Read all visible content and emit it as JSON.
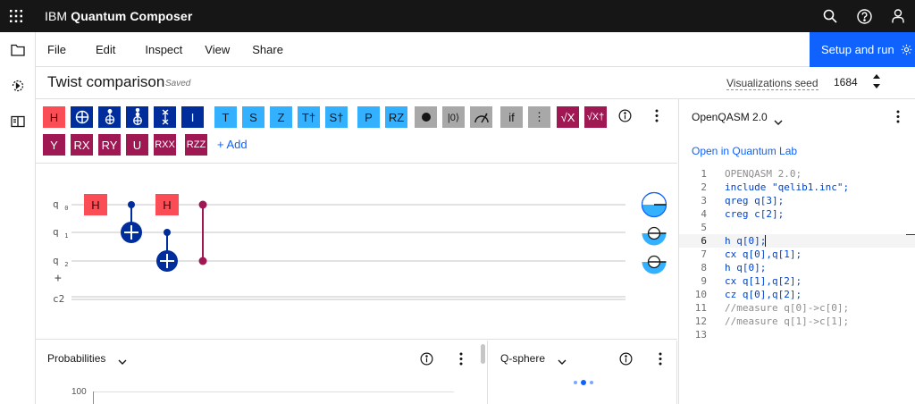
{
  "app": {
    "brand_prefix": "IBM",
    "brand_name": "Quantum Composer"
  },
  "menu": [
    "File",
    "Edit",
    "Inspect",
    "View",
    "Share"
  ],
  "setup_button": "Setup and run",
  "circuit_title": "Twist comparison",
  "save_status": "Saved",
  "visualizations_seed": {
    "label": "Visualizations seed",
    "value": "1684"
  },
  "gates_row1": [
    {
      "label": "H",
      "style": "red"
    },
    {
      "label": "⊕",
      "style": "navy"
    },
    {
      "label": "ccx",
      "style": "navy"
    },
    {
      "label": "ccx2",
      "style": "navy"
    },
    {
      "label": "swap",
      "style": "navy"
    },
    {
      "label": "I",
      "style": "navy"
    },
    {
      "label": "T",
      "style": "cyan"
    },
    {
      "label": "S",
      "style": "cyan"
    },
    {
      "label": "Z",
      "style": "cyan"
    },
    {
      "label": "T†",
      "style": "cyan"
    },
    {
      "label": "S†",
      "style": "cyan"
    },
    {
      "label": "P",
      "style": "cyan"
    },
    {
      "label": "RZ",
      "style": "cyan"
    },
    {
      "label": "●",
      "style": "gray"
    },
    {
      "label": "|0⟩",
      "style": "gray"
    },
    {
      "label": "measure",
      "style": "gray"
    },
    {
      "label": "if",
      "style": "gray"
    },
    {
      "label": "⋮",
      "style": "gray"
    },
    {
      "label": "√X",
      "style": "maroon"
    },
    {
      "label": "√X†",
      "style": "maroon"
    }
  ],
  "gates_row2": [
    {
      "label": "Y",
      "style": "maroon"
    },
    {
      "label": "RX",
      "style": "maroon"
    },
    {
      "label": "RY",
      "style": "maroon"
    },
    {
      "label": "U",
      "style": "maroon"
    },
    {
      "label": "RXX",
      "style": "maroon"
    },
    {
      "label": "RZZ",
      "style": "maroon"
    }
  ],
  "add_link": "+ Add",
  "qubits": [
    "q",
    "q",
    "q"
  ],
  "qubit_indices": [
    "0",
    "1",
    "2"
  ],
  "classical_register": "c2",
  "add_qubit": "+",
  "panels": {
    "probabilities": "Probabilities",
    "qsphere": "Q-sphere",
    "prob_axis_top": "100"
  },
  "code_panel": {
    "language": "OpenQASM 2.0",
    "open_lab": "Open in Quantum Lab"
  },
  "code_lines": [
    "OPENQASM 2.0;",
    "include \"qelib1.inc\";",
    "qreg q[3];",
    "creg c[2];",
    "",
    "h q[0];",
    "cx q[0],q[1];",
    "h q[0];",
    "cx q[1],q[2];",
    "cz q[0],q[2];",
    "//measure q[0]->c[0];",
    "//measure q[1]->c[1];",
    ""
  ],
  "colors": {
    "accent": "#0f62fe",
    "h_gate": "#fa4d56",
    "navy_gate": "#002d9c",
    "cyan_gate": "#33b1ff",
    "maroon_gate": "#9f1853"
  }
}
